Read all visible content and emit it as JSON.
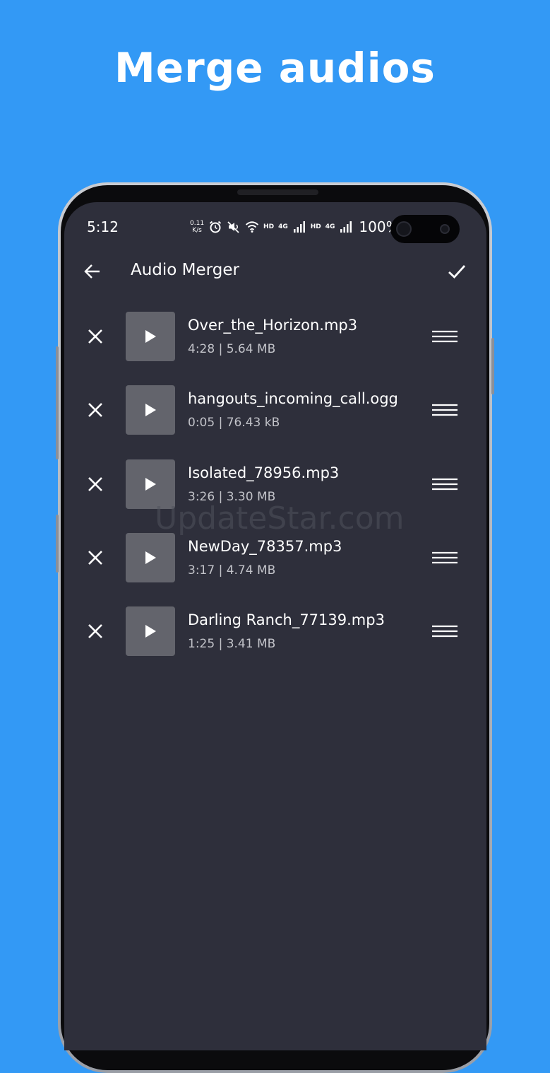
{
  "promo": {
    "title": "Merge audios",
    "background_color": "#3399f5"
  },
  "status_bar": {
    "time": "5:12",
    "net_speed_value": "0.11",
    "net_speed_unit": "K/s",
    "hd_label_1": "HD",
    "hd_label_2": "HD",
    "network_label_1": "4G",
    "network_label_2": "4G",
    "battery": "100%"
  },
  "toolbar": {
    "title": "Audio Merger",
    "back_icon": "arrow-left-icon",
    "confirm_icon": "check-icon"
  },
  "tracks": [
    {
      "name": "Over_the_Horizon.mp3",
      "meta": "4:28 | 5.64 MB"
    },
    {
      "name": "hangouts_incoming_call.ogg",
      "meta": "0:05 | 76.43 kB"
    },
    {
      "name": "Isolated_78956.mp3",
      "meta": "3:26 | 3.30 MB"
    },
    {
      "name": "NewDay_78357.mp3",
      "meta": "3:17 | 4.74 MB"
    },
    {
      "name": "Darling Ranch_77139.mp3",
      "meta": "1:25 | 3.41 MB"
    }
  ],
  "watermark": "UpdateStar.com",
  "colors": {
    "screen_bg": "#2e2f3b",
    "play_tile": "#63646c",
    "meta_text": "#c2c3c9"
  }
}
